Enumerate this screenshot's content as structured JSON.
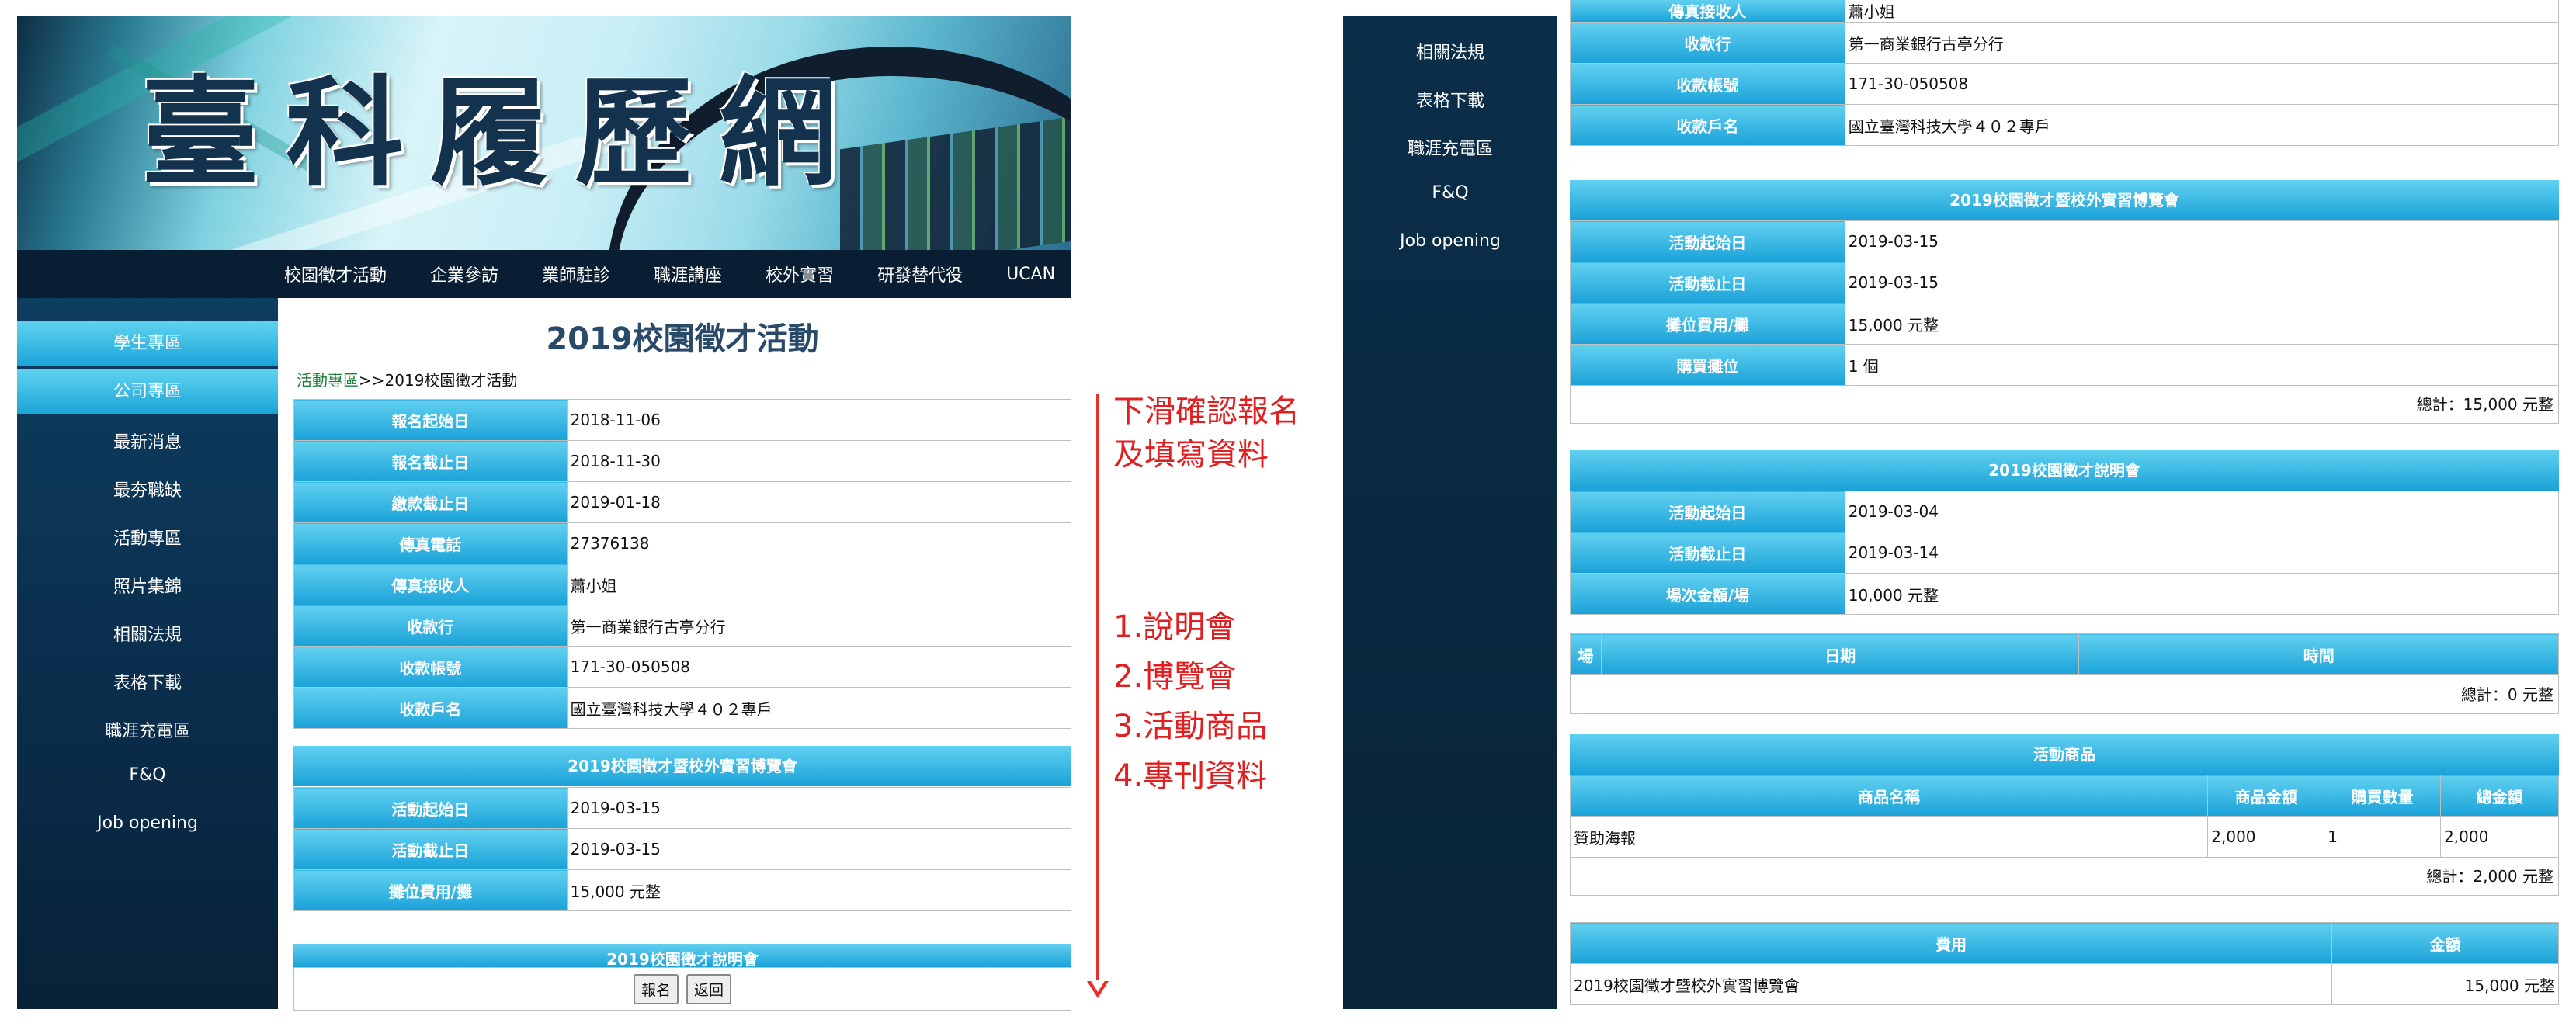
{
  "left": {
    "banner_title": "臺科履歷網",
    "top_nav": [
      "校園徵才活動",
      "企業參訪",
      "業師駐診",
      "職涯講座",
      "校外實習",
      "研發替代役",
      "UCAN"
    ],
    "sidebar": [
      "學生專區",
      "公司專區",
      "最新消息",
      "最夯職缺",
      "活動專區",
      "照片集錦",
      "相關法規",
      "表格下載",
      "職涯充電區",
      "F&Q",
      "Job opening"
    ],
    "page_title": "2019校園徵才活動",
    "breadcrumb": {
      "link": "活動專區",
      "sep": ">>",
      "current": "2019校園徵才活動"
    },
    "info_rows": [
      {
        "label": "報名起始日",
        "value": "2018-11-06"
      },
      {
        "label": "報名截止日",
        "value": "2018-11-30"
      },
      {
        "label": "繳款截止日",
        "value": "2019-01-18"
      },
      {
        "label": "傳真電話",
        "value": "27376138"
      },
      {
        "label": "傳真接收人",
        "value": "蕭小姐"
      },
      {
        "label": "收款行",
        "value": "第一商業銀行古亭分行"
      },
      {
        "label": "收款帳號",
        "value": "171-30-050508"
      },
      {
        "label": "收款戶名",
        "value": "國立臺灣科技大學４０２專戶"
      }
    ],
    "fair_section": {
      "title": "2019校園徵才暨校外實習博覽會",
      "rows": [
        {
          "label": "活動起始日",
          "value": "2019-03-15"
        },
        {
          "label": "活動截止日",
          "value": "2019-03-15"
        },
        {
          "label": "攤位費用/攤",
          "value": "15,000 元整"
        }
      ]
    },
    "partial_section_title": "2019校園徵才說明會",
    "buttons": {
      "register": "報名",
      "back": "返回"
    }
  },
  "annotations": {
    "line1": "下滑確認報名",
    "line2": "及填寫資料",
    "list": [
      "1.說明會",
      "2.博覽會",
      "3.活動商品",
      "4.專刊資料"
    ],
    "arrow_color": "#e83030"
  },
  "right": {
    "sidebar": [
      "相關法規",
      "表格下載",
      "職涯充電區",
      "F&Q",
      "Job opening"
    ],
    "partial_top_label": "傳真接收人",
    "partial_top_value": "蕭小姐",
    "payment_rows": [
      {
        "label": "收款行",
        "value": "第一商業銀行古亭分行"
      },
      {
        "label": "收款帳號",
        "value": "171-30-050508"
      },
      {
        "label": "收款戶名",
        "value": "國立臺灣科技大學４０２專戶"
      }
    ],
    "fair": {
      "title": "2019校園徵才暨校外實習博覽會",
      "rows": [
        {
          "label": "活動起始日",
          "value": "2019-03-15"
        },
        {
          "label": "活動截止日",
          "value": "2019-03-15"
        },
        {
          "label": "攤位費用/攤",
          "value": "15,000 元整"
        },
        {
          "label": "購買攤位",
          "value": "1 個"
        }
      ],
      "total": "總計：15,000 元整"
    },
    "briefing": {
      "title": "2019校園徵才說明會",
      "rows": [
        {
          "label": "活動起始日",
          "value": "2019-03-04"
        },
        {
          "label": "活動截止日",
          "value": "2019-03-14"
        },
        {
          "label": "場次金額/場",
          "value": "10,000 元整"
        }
      ],
      "session_headers": [
        "場",
        "日期",
        "時間"
      ],
      "total": "總計：0 元整"
    },
    "products": {
      "title": "活動商品",
      "headers": [
        "商品名稱",
        "商品金額",
        "購買數量",
        "總金額"
      ],
      "rows": [
        {
          "name": "贊助海報",
          "price": "2,000",
          "qty": "1",
          "amount": "2,000"
        }
      ],
      "total": "總計：2,000 元整"
    },
    "fees": {
      "headers": [
        "費用",
        "金額"
      ],
      "rows": [
        {
          "item": "2019校園徵才暨校外實習博覽會",
          "amount": "15,000 元整"
        }
      ]
    }
  }
}
